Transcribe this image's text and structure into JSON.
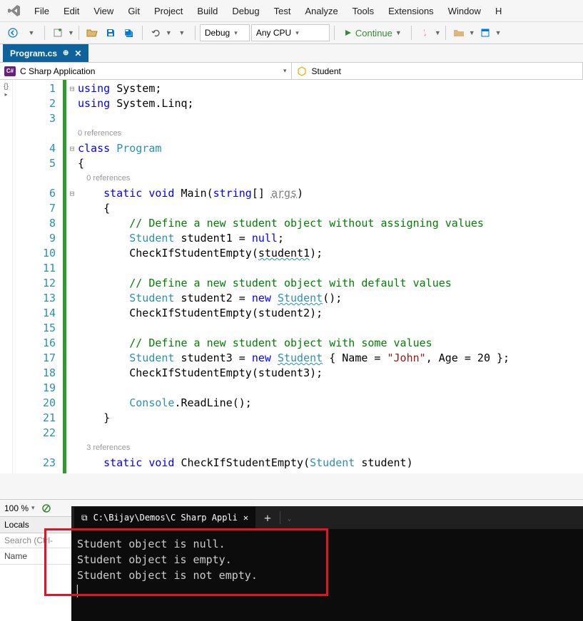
{
  "menu": {
    "items": [
      "File",
      "Edit",
      "View",
      "Git",
      "Project",
      "Build",
      "Debug",
      "Test",
      "Analyze",
      "Tools",
      "Extensions",
      "Window",
      "H"
    ]
  },
  "toolbar": {
    "config": "Debug",
    "platform": "Any CPU",
    "continue": "Continue"
  },
  "tab": {
    "title": "Program.cs"
  },
  "nav": {
    "scope": "C Sharp Application",
    "member": "Student"
  },
  "zoom": {
    "value": "100 %"
  },
  "locals": {
    "title": "Locals",
    "search": "Search (Ctrl-",
    "col1": "Name"
  },
  "terminal": {
    "tab_title": "C:\\Bijay\\Demos\\C Sharp Appli",
    "lines": [
      "Student object is null.",
      "Student object is empty.",
      "Student object is not empty."
    ]
  },
  "code": {
    "codelens1": "0 references",
    "codelens2": "0 references",
    "codelens3": "3 references",
    "lines": {
      "1": {
        "pre": "",
        "tokens": [
          {
            "t": "using ",
            "c": "kw"
          },
          {
            "t": "System;",
            "c": ""
          }
        ]
      },
      "2": {
        "pre": "",
        "tokens": [
          {
            "t": "using ",
            "c": "kw"
          },
          {
            "t": "System.Linq;",
            "c": ""
          }
        ]
      },
      "3": {
        "pre": "",
        "tokens": []
      },
      "4": {
        "pre": "",
        "tokens": [
          {
            "t": "class ",
            "c": "kw"
          },
          {
            "t": "Program",
            "c": "type"
          }
        ]
      },
      "5": {
        "pre": "",
        "tokens": [
          {
            "t": "{",
            "c": ""
          }
        ]
      },
      "6": {
        "pre": "    ",
        "tokens": [
          {
            "t": "static ",
            "c": "kw"
          },
          {
            "t": "void ",
            "c": "kw"
          },
          {
            "t": "Main(",
            "c": ""
          },
          {
            "t": "string",
            "c": "kw"
          },
          {
            "t": "[] ",
            "c": ""
          },
          {
            "t": "args",
            "c": "param"
          },
          {
            "t": ")",
            "c": ""
          }
        ]
      },
      "7": {
        "pre": "    ",
        "tokens": [
          {
            "t": "{",
            "c": ""
          }
        ]
      },
      "8": {
        "pre": "        ",
        "tokens": [
          {
            "t": "// Define a new student object without assigning values",
            "c": "com"
          }
        ]
      },
      "9": {
        "pre": "        ",
        "tokens": [
          {
            "t": "Student",
            "c": "type"
          },
          {
            "t": " student1 = ",
            "c": ""
          },
          {
            "t": "null",
            "c": "kw"
          },
          {
            "t": ";",
            "c": ""
          }
        ]
      },
      "10": {
        "pre": "        ",
        "tokens": [
          {
            "t": "CheckIfStudentEmpty(",
            "c": ""
          },
          {
            "t": "student1",
            "c": "ident-u"
          },
          {
            "t": ");",
            "c": ""
          }
        ]
      },
      "11": {
        "pre": "",
        "tokens": []
      },
      "12": {
        "pre": "        ",
        "tokens": [
          {
            "t": "// Define a new student object with default values",
            "c": "com"
          }
        ]
      },
      "13": {
        "pre": "        ",
        "tokens": [
          {
            "t": "Student",
            "c": "type"
          },
          {
            "t": " student2 = ",
            "c": ""
          },
          {
            "t": "new ",
            "c": "kw"
          },
          {
            "t": "Student",
            "c": "type ident-u"
          },
          {
            "t": "();",
            "c": ""
          }
        ]
      },
      "14": {
        "pre": "        ",
        "tokens": [
          {
            "t": "CheckIfStudentEmpty(student2);",
            "c": ""
          }
        ]
      },
      "15": {
        "pre": "",
        "tokens": []
      },
      "16": {
        "pre": "        ",
        "tokens": [
          {
            "t": "// Define a new student object with some values",
            "c": "com"
          }
        ]
      },
      "17": {
        "pre": "        ",
        "tokens": [
          {
            "t": "Student",
            "c": "type"
          },
          {
            "t": " student3 = ",
            "c": ""
          },
          {
            "t": "new ",
            "c": "kw"
          },
          {
            "t": "Student",
            "c": "type ident-u"
          },
          {
            "t": " { Name = ",
            "c": ""
          },
          {
            "t": "\"John\"",
            "c": "str"
          },
          {
            "t": ", Age = 20 };",
            "c": ""
          }
        ]
      },
      "18": {
        "pre": "        ",
        "tokens": [
          {
            "t": "CheckIfStudentEmpty(student3);",
            "c": ""
          }
        ]
      },
      "19": {
        "pre": "",
        "tokens": []
      },
      "20": {
        "pre": "        ",
        "tokens": [
          {
            "t": "Console",
            "c": "type"
          },
          {
            "t": ".ReadLine();",
            "c": ""
          }
        ]
      },
      "21": {
        "pre": "    ",
        "tokens": [
          {
            "t": "}",
            "c": ""
          }
        ]
      },
      "22": {
        "pre": "",
        "tokens": []
      },
      "23": {
        "pre": "    ",
        "tokens": [
          {
            "t": "static ",
            "c": "kw"
          },
          {
            "t": "void ",
            "c": "kw"
          },
          {
            "t": "CheckIfStudentEmpty(",
            "c": ""
          },
          {
            "t": "Student",
            "c": "type"
          },
          {
            "t": " student)",
            "c": ""
          }
        ]
      }
    },
    "line_numbers": [
      1,
      2,
      3,
      4,
      5,
      6,
      7,
      8,
      9,
      10,
      11,
      12,
      13,
      14,
      15,
      16,
      17,
      18,
      19,
      20,
      21,
      22,
      23
    ]
  }
}
